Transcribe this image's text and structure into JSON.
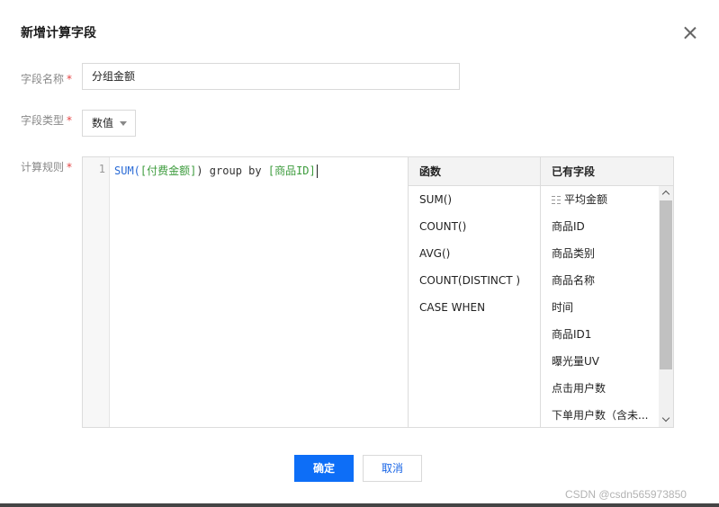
{
  "dialog": {
    "title": "新增计算字段"
  },
  "form": {
    "name_label": "字段名称",
    "name_value": "分组金额",
    "type_label": "字段类型",
    "type_value": "数值",
    "rule_label": "计算规则",
    "required_mark": "*"
  },
  "editor": {
    "line_number": "1",
    "code": {
      "fn": "SUM(",
      "field1": "[付费金额]",
      "mid": ") group by ",
      "field2": "[商品ID]"
    }
  },
  "functions": {
    "header": "函数",
    "items": [
      "SUM()",
      "COUNT()",
      "AVG()",
      "COUNT(DISTINCT )",
      "CASE WHEN"
    ]
  },
  "fields": {
    "header": "已有字段",
    "items": [
      "平均金额",
      "商品ID",
      "商品类别",
      "商品名称",
      "时间",
      "商品ID1",
      "曝光量UV",
      "点击用户数",
      "下单用户数（含未..."
    ]
  },
  "buttons": {
    "ok": "确定",
    "cancel": "取消"
  },
  "watermark": "CSDN @csdn565973850",
  "colors": {
    "primary": "#0d6ef7",
    "required": "#e54545",
    "function_text": "#2a6bd6",
    "field_text": "#3c9b3c"
  }
}
